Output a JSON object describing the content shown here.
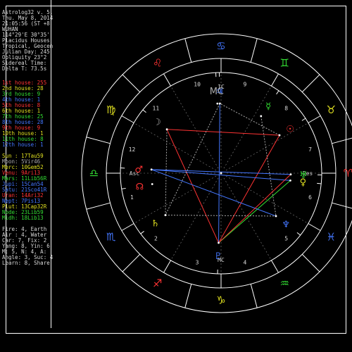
{
  "colors": {
    "bg": "#000000",
    "line": "#ffffff",
    "fire": "#ff3333",
    "earth": "#e0e020",
    "air": "#33dd33",
    "water": "#4477ff",
    "grey": "#aaaaaa",
    "purple": "#cc44ff"
  },
  "info_lines": [
    "Astrolog32 v. 5.",
    "Thu. May 8, 2014",
    "21:05:56 (ST +8",
    "WUHAN",
    "114°29'E 30°35'",
    "Placidus Houses",
    "Tropical, Geocen",
    "Julian Day: 245",
    "Obliquity 23°2",
    "Sidereal Time:",
    "Delta T: 73.5s"
  ],
  "house_list": [
    {
      "label": "1st house: 255",
      "color": "#ff3333"
    },
    {
      "label": "2nd house: 28",
      "color": "#e0e020"
    },
    {
      "label": "3rd house: 9",
      "color": "#33dd33"
    },
    {
      "label": "4th house: 1",
      "color": "#4477ff"
    },
    {
      "label": "5th house: 8",
      "color": "#ff3333"
    },
    {
      "label": "6th house: 1",
      "color": "#e0e020"
    },
    {
      "label": "7th house: 25",
      "color": "#33dd33"
    },
    {
      "label": "8th house: 28",
      "color": "#4477ff"
    },
    {
      "label": "9th house: 9",
      "color": "#ff3333"
    },
    {
      "label": "10th house: 1",
      "color": "#e0e020"
    },
    {
      "label": "11th house: 8",
      "color": "#33dd33"
    },
    {
      "label": "12th house: 1",
      "color": "#4477ff"
    }
  ],
  "planet_list": [
    {
      "label": "Sun : 17Tau59",
      "color": "#e0e020"
    },
    {
      "label": "Moon: 5Vir46",
      "color": "#aaaaaa"
    },
    {
      "label": "Merc: 10Gem52",
      "color": "#e0e020"
    },
    {
      "label": "Venu: 9Ari13",
      "color": "#ff3333"
    },
    {
      "label": "Mars: 11Lib56R",
      "color": "#33dd33"
    },
    {
      "label": "Jupi: 15Can54",
      "color": "#4477ff"
    },
    {
      "label": "Satu: 21Sco41R",
      "color": "#4477ff"
    },
    {
      "label": "Uran: 14Ari32",
      "color": "#ff3333"
    },
    {
      "label": "Nept: 7Pis13",
      "color": "#4477ff"
    },
    {
      "label": "Plut: 13Cap32R",
      "color": "#e0e020"
    },
    {
      "label": "Node: 23Lib59",
      "color": "#33dd33"
    },
    {
      "label": "Midh: 18Lib13",
      "color": "#33dd33"
    }
  ],
  "element_lines": [
    "Fire: 4, Earth",
    "Air : 4, Water",
    "Car: 7, Fix: 2",
    "Yang: 8, Yin: 6",
    "M: 5, N: 4, A:",
    "Angle: 3, Suc: 4",
    "Learn: 8, Share"
  ],
  "chart_data": {
    "type": "astrological wheel",
    "signs": [
      {
        "name": "Aries",
        "glyph": "♈",
        "color": "#ff3333"
      },
      {
        "name": "Taurus",
        "glyph": "♉",
        "color": "#e0e020"
      },
      {
        "name": "Gemini",
        "glyph": "♊",
        "color": "#33dd33"
      },
      {
        "name": "Cancer",
        "glyph": "♋",
        "color": "#4477ff"
      },
      {
        "name": "Leo",
        "glyph": "♌",
        "color": "#ff3333"
      },
      {
        "name": "Virgo",
        "glyph": "♍",
        "color": "#e0e020"
      },
      {
        "name": "Libra",
        "glyph": "♎",
        "color": "#33dd33"
      },
      {
        "name": "Scorpio",
        "glyph": "♏",
        "color": "#4477ff"
      },
      {
        "name": "Sagittarius",
        "glyph": "♐",
        "color": "#ff3333"
      },
      {
        "name": "Capricorn",
        "glyph": "♑",
        "color": "#e0e020"
      },
      {
        "name": "Aquarius",
        "glyph": "♒",
        "color": "#33dd33"
      },
      {
        "name": "Pisces",
        "glyph": "♓",
        "color": "#4477ff"
      }
    ],
    "ascendant_longitude": 195,
    "house_numbers": [
      "1",
      "2",
      "3",
      "4",
      "5",
      "6",
      "7",
      "8",
      "9",
      "10",
      "11",
      "12"
    ],
    "axis_labels": {
      "asc": "Asc",
      "desc": "Des",
      "mc": "MC",
      "ic": "IC"
    },
    "planets": [
      {
        "name": "Sun",
        "glyph": "☉",
        "longitude": 48,
        "color": "#ff3333"
      },
      {
        "name": "Moon",
        "glyph": "☽",
        "longitude": 156,
        "color": "#aaaaaa"
      },
      {
        "name": "Mercury",
        "glyph": "☿",
        "longitude": 70,
        "color": "#33dd33"
      },
      {
        "name": "Venus",
        "glyph": "♀",
        "longitude": 9,
        "color": "#e0e020"
      },
      {
        "name": "Mars",
        "glyph": "♂",
        "longitude": 192,
        "color": "#ff3333"
      },
      {
        "name": "Jupiter",
        "glyph": "♃",
        "longitude": 106,
        "color": "#4477ff"
      },
      {
        "name": "Saturn",
        "glyph": "♄",
        "longitude": 232,
        "color": "#e0e020"
      },
      {
        "name": "Uranus",
        "glyph": "♅",
        "longitude": 14,
        "color": "#33dd33"
      },
      {
        "name": "Neptune",
        "glyph": "♆",
        "longitude": 337,
        "color": "#4477ff"
      },
      {
        "name": "Pluto",
        "glyph": "♇",
        "longitude": 283,
        "color": "#4477ff"
      },
      {
        "name": "North Node",
        "glyph": "☊",
        "longitude": 204,
        "color": "#ff3333"
      },
      {
        "name": "Midheaven",
        "glyph": "MC",
        "longitude": 108,
        "color": "#aaaaaa"
      }
    ],
    "aspects": [
      {
        "from": "Sun",
        "to": "Pluto",
        "color": "#ff3333"
      },
      {
        "from": "Sun",
        "to": "Moon",
        "color": "#ff3333"
      },
      {
        "from": "Moon",
        "to": "Pluto",
        "color": "#ff3333"
      },
      {
        "from": "Mars",
        "to": "Uranus",
        "color": "#4477ff"
      },
      {
        "from": "Mars",
        "to": "Venus",
        "color": "#4477ff"
      },
      {
        "from": "Jupiter",
        "to": "Pluto",
        "color": "#4477ff"
      },
      {
        "from": "Jupiter",
        "to": "Saturn",
        "color": "#aaaaaa"
      },
      {
        "from": "Mercury",
        "to": "Neptune",
        "color": "#aaaaaa"
      },
      {
        "from": "Venus",
        "to": "Pluto",
        "color": "#33dd33"
      },
      {
        "from": "Saturn",
        "to": "Neptune",
        "color": "#aaaaaa"
      },
      {
        "from": "Moon",
        "to": "Saturn",
        "color": "#aaaaaa"
      },
      {
        "from": "Sun",
        "to": "Jupiter",
        "color": "#aaaaaa"
      },
      {
        "from": "Mars",
        "to": "Neptune",
        "color": "#4477ff"
      },
      {
        "from": "Uranus",
        "to": "Pluto",
        "color": "#ff3333"
      }
    ]
  }
}
